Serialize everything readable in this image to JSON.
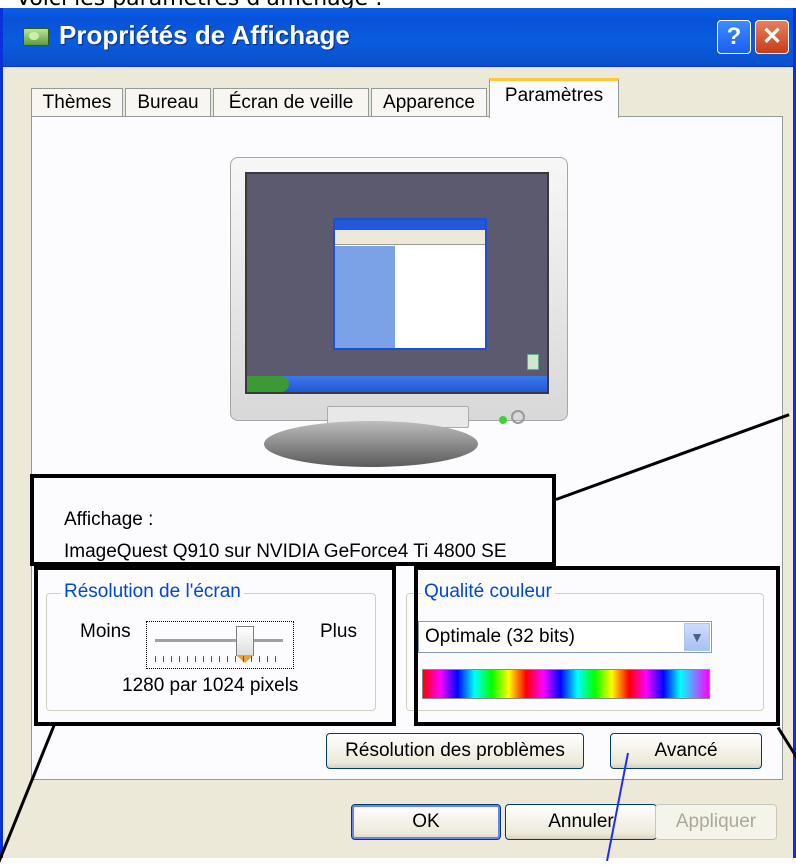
{
  "caption": "Voici les paramètres d'affichage :",
  "window": {
    "title": "Propriétés de Affichage",
    "help_label": "?",
    "close_label": "✕"
  },
  "tabs": [
    {
      "label": "Thèmes",
      "active": false
    },
    {
      "label": "Bureau",
      "active": false
    },
    {
      "label": "Écran de veille",
      "active": false
    },
    {
      "label": "Apparence",
      "active": false
    },
    {
      "label": "Paramètres",
      "active": true
    }
  ],
  "display": {
    "label": "Affichage :",
    "value": "ImageQuest Q910 sur NVIDIA GeForce4 Ti 4800 SE"
  },
  "resolution": {
    "legend": "Résolution de l'écran",
    "min_label": "Moins",
    "max_label": "Plus",
    "value": "1280 par 1024 pixels",
    "slider_level": 0.7
  },
  "color_quality": {
    "legend": "Qualité couleur",
    "selected": "Optimale (32 bits)"
  },
  "buttons": {
    "troubleshoot": "Résolution des problèmes",
    "advanced": "Avancé",
    "ok": "OK",
    "cancel": "Annuler",
    "apply": "Appliquer"
  },
  "colors": {
    "title_bar": "#0a5ee8",
    "dialog_bg": "#ece9d8",
    "group_legend": "#0046d5",
    "active_tab_accent": "#ffc83c",
    "annotation_box": "#000000",
    "annotation_line_blue": "#1e30e6"
  }
}
